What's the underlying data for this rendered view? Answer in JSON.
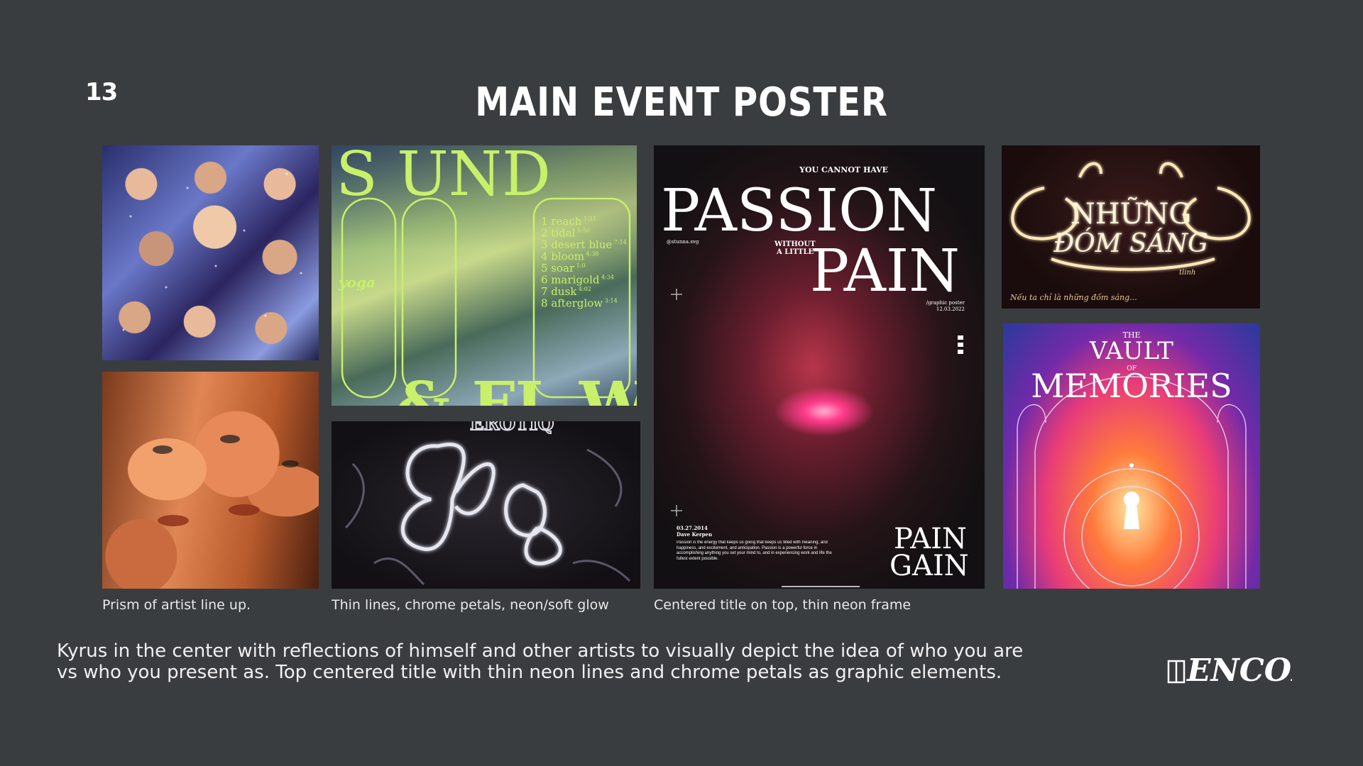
{
  "slide": {
    "number": "13",
    "title": "MAIN EVENT POSTER"
  },
  "captions": {
    "prism": "Prism of artist line up.",
    "petals": "Thin lines, chrome petals, neon/soft glow",
    "centered": "Centered title on top, thin neon frame"
  },
  "description": {
    "line1": "Kyrus in the center with reflections of himself and other artists to visually depict the idea of who you are",
    "line2": "vs who you present as. Top centered title with thin neon lines and chrome petals as graphic elements."
  },
  "posters": {
    "sound": {
      "title_top": "S   UND",
      "title_bottom": "& FL  W",
      "brand": "yoga",
      "tracks": [
        {
          "n": "1",
          "name": "reach",
          "time": "1:21"
        },
        {
          "n": "2",
          "name": "tidal",
          "time": "5:50"
        },
        {
          "n": "3",
          "name": "desert blue",
          "time": "7:14"
        },
        {
          "n": "4",
          "name": "bloom",
          "time": "4:38"
        },
        {
          "n": "5",
          "name": "soar",
          "time": "1:0"
        },
        {
          "n": "6",
          "name": "marigold",
          "time": "4:34"
        },
        {
          "n": "7",
          "name": "dusk",
          "time": "4:02"
        },
        {
          "n": "8",
          "name": "afterglow",
          "time": "3:14"
        }
      ]
    },
    "erotiq": {
      "title": "EROTIQ"
    },
    "passion": {
      "tagline": "YOU CANNOT HAVE",
      "word1": "PASSION",
      "word2": "PAIN",
      "without": "WITHOUT",
      "alittle": "A LITTLE",
      "handle": "@stunna.svg",
      "meta1": "/graphic poster",
      "meta2": "12.03.2022",
      "date": "03.27.2014",
      "author": "Dave Kerpen",
      "body": "Passion is the energy that keeps us going that keeps us filled with meaning, and happiness, and excitement, and anticipation. Passion is a powerful force in accomplishing anything you set your mind to, and in experiencing work and life the fullest extent possible.",
      "corner1": "PAIN",
      "corner2": "GAIN"
    },
    "nhung": {
      "title1": "NHỮNG",
      "title2": "ĐÓM SÁNG",
      "sub": "tlinh",
      "line": "Nếu ta chỉ là những đốm sáng..."
    },
    "vault": {
      "the": "THE",
      "vault": "VAULT",
      "of": "OF",
      "memories": "MEMORIES"
    }
  },
  "logo": {
    "text": "ENCORE",
    "mark": "HB"
  },
  "colors": {
    "background": "#3a3d40",
    "neon_green": "#c8f06a"
  }
}
